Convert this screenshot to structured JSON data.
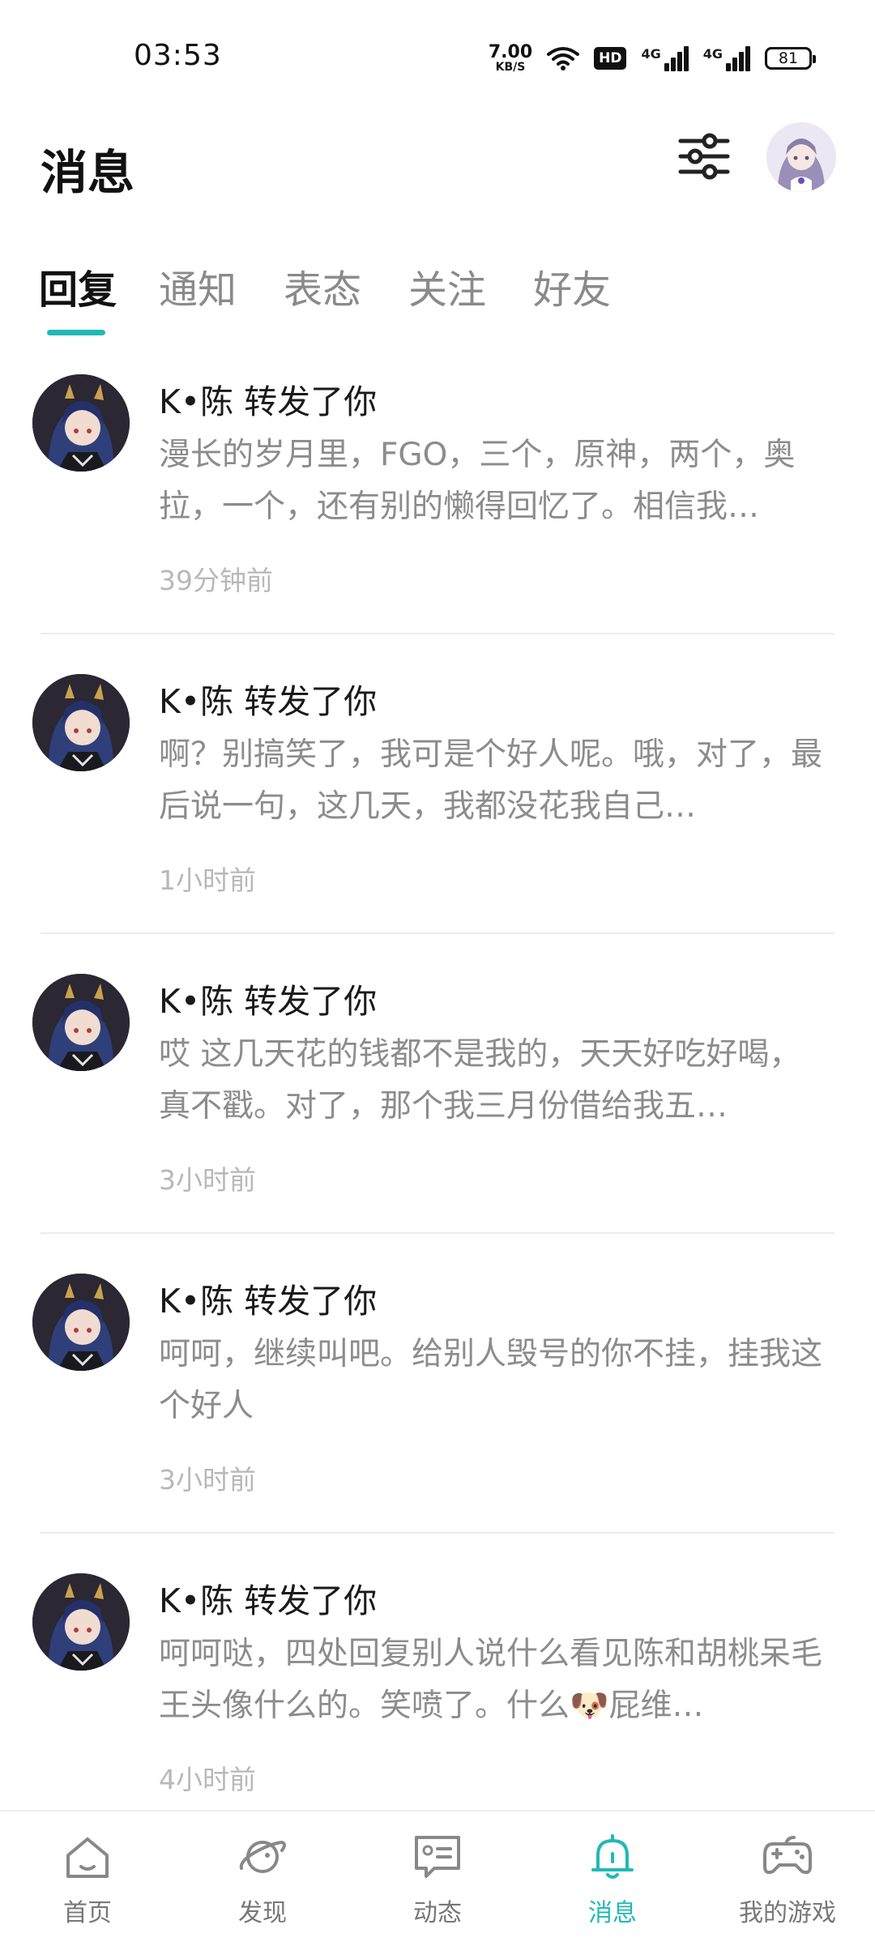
{
  "status_bar": {
    "time": "03:53",
    "net_speed_value": "7.00",
    "net_speed_unit": "KB/S",
    "hd_label": "HD",
    "signal1_label": "4G",
    "signal2_label": "4G",
    "battery": "81"
  },
  "header": {
    "title": "消息"
  },
  "tabs": [
    {
      "label": "回复",
      "active": true
    },
    {
      "label": "通知",
      "active": false
    },
    {
      "label": "表态",
      "active": false
    },
    {
      "label": "关注",
      "active": false
    },
    {
      "label": "好友",
      "active": false
    }
  ],
  "messages": [
    {
      "title": "K•陈 转发了你",
      "body": "漫长的岁月里，FGO，三个，原神，两个，奥拉，一个，还有别的懒得回忆了。相信我…",
      "time": "39分钟前"
    },
    {
      "title": "K•陈 转发了你",
      "body": "啊？别搞笑了，我可是个好人呢。哦，对了，最后说一句，这几天，我都没花我自己…",
      "time": "1小时前"
    },
    {
      "title": "K•陈 转发了你",
      "body": "哎 这几天花的钱都不是我的，天天好吃好喝，真不戳。对了，那个我三月份借给我五…",
      "time": "3小时前"
    },
    {
      "title": "K•陈 转发了你",
      "body": "呵呵，继续叫吧。给别人毁号的你不挂，挂我这个好人",
      "time": "3小时前"
    },
    {
      "title": "K•陈 转发了你",
      "body": "呵呵哒，四处回复别人说什么看见陈和胡桃呆毛王头像什么的。笑喷了。什么🐶屁维…",
      "time": "4小时前"
    }
  ],
  "bottom_nav": [
    {
      "label": "首页",
      "icon": "home-icon",
      "active": false
    },
    {
      "label": "发现",
      "icon": "planet-icon",
      "active": false
    },
    {
      "label": "动态",
      "icon": "chat-card-icon",
      "active": false
    },
    {
      "label": "消息",
      "icon": "bell-icon",
      "active": true
    },
    {
      "label": "我的游戏",
      "icon": "gamepad-icon",
      "active": false
    }
  ],
  "colors": {
    "accent": "#21b9b4",
    "text_primary": "#1a1a1a",
    "text_secondary": "#8c8c8c",
    "text_time": "#b8b8b8"
  }
}
